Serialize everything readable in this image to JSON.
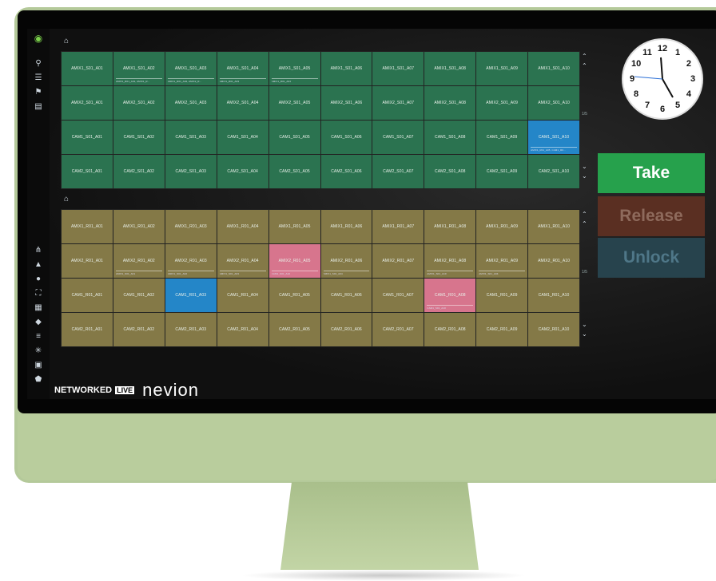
{
  "sidebar": {
    "top_icons": [
      "logo-icon",
      "routing-icon",
      "layers-icon",
      "tree-icon",
      "list-icon"
    ],
    "bottom_icons": [
      "network-icon",
      "triangle-icon",
      "eye-icon",
      "expand-icon",
      "grid-icon",
      "pin-icon",
      "list-icon",
      "snowflake-icon",
      "document-icon",
      "shield-icon"
    ]
  },
  "panels": [
    {
      "color": "#2b7350",
      "pager": "1/5",
      "rows": [
        [
          "AMIX1_S01_A01",
          "AMIX1_S01_A02",
          "AMIX1_S01_A03",
          "AMIX1_S01_A04",
          "AMIX1_S01_A05",
          "AMIX1_S01_A06",
          "AMIX1_S01_A07",
          "AMIX1_S01_A08",
          "AMIX1_S01_A09",
          "AMIX1_S01_A10"
        ],
        [
          "AMIX2_S01_A01",
          "AMIX2_S01_A02",
          "AMIX2_S01_A03",
          "AMIX2_S01_A04",
          "AMIX2_S01_A05",
          "AMIX2_S01_A06",
          "AMIX2_S01_A07",
          "AMIX2_S01_A08",
          "AMIX2_S01_A09",
          "AMIX2_S01_A10"
        ],
        [
          "CAM1_S01_A01",
          "CAM1_S01_A02",
          "CAM1_S01_A03",
          "CAM1_S01_A04",
          "CAM1_S01_A05",
          "CAM1_S01_A06",
          "CAM1_S01_A07",
          "CAM1_S01_A08",
          "CAM1_S01_A09",
          "CAM1_S01_A10"
        ],
        [
          "CAM2_S01_A01",
          "CAM2_S01_A02",
          "CAM2_S01_A03",
          "CAM2_S01_A04",
          "CAM2_S01_A05",
          "CAM2_S01_A06",
          "CAM2_S01_A07",
          "CAM2_S01_A08",
          "CAM2_S01_A09",
          "CAM2_S01_A10"
        ]
      ],
      "highlights": [
        {
          "row": 2,
          "col": 9,
          "kind": "blue"
        }
      ],
      "subs": [
        {
          "row": 0,
          "col": 1,
          "text": "AMIX1_R01_A01, AMIX1_R..."
        },
        {
          "row": 0,
          "col": 2,
          "text": "AMIX1_R01_A02, AMIX2_R..."
        },
        {
          "row": 0,
          "col": 3,
          "text": "AMIX1_R01_A03"
        },
        {
          "row": 0,
          "col": 4,
          "text": "AMIX1_R01_A04"
        },
        {
          "row": 2,
          "col": 9,
          "text": "AMIX1_R01_A05, CAM1_R0..."
        }
      ]
    },
    {
      "color": "#847947",
      "pager": "1/5",
      "rows": [
        [
          "AMIX1_R01_A01",
          "AMIX1_R01_A02",
          "AMIX1_R01_A03",
          "AMIX1_R01_A04",
          "AMIX1_R01_A05",
          "AMIX1_R01_A06",
          "AMIX1_R01_A07",
          "AMIX1_R01_A08",
          "AMIX1_R01_A09",
          "AMIX1_R01_A10"
        ],
        [
          "AMIX2_R01_A01",
          "AMIX2_R01_A02",
          "AMIX2_R01_A03",
          "AMIX2_R01_A04",
          "AMIX2_R01_A05",
          "AMIX2_R01_A06",
          "AMIX2_R01_A07",
          "AMIX2_R01_A08",
          "AMIX2_R01_A09",
          "AMIX2_R01_A10"
        ],
        [
          "CAM1_R01_A01",
          "CAM1_R01_A02",
          "CAM1_R01_A03",
          "CAM1_R01_A04",
          "CAM1_R01_A05",
          "CAM1_R01_A06",
          "CAM1_R01_A07",
          "CAM1_R01_A08",
          "CAM1_R01_A09",
          "CAM1_R01_A10"
        ],
        [
          "CAM2_R01_A01",
          "CAM2_R01_A02",
          "CAM2_R01_A03",
          "CAM2_R01_A04",
          "CAM2_R01_A05",
          "CAM2_R01_A06",
          "CAM2_R01_A07",
          "CAM2_R01_A08",
          "CAM2_R01_A09",
          "CAM2_R01_A10"
        ]
      ],
      "highlights": [
        {
          "row": 1,
          "col": 4,
          "kind": "pink"
        },
        {
          "row": 2,
          "col": 2,
          "kind": "blue"
        },
        {
          "row": 2,
          "col": 7,
          "kind": "pink"
        }
      ],
      "subs": [
        {
          "row": 1,
          "col": 1,
          "text": "AMIX1_S01_A01"
        },
        {
          "row": 1,
          "col": 2,
          "text": "AMIX1_S01_A02"
        },
        {
          "row": 1,
          "col": 3,
          "text": "AMIX1_S01_A03"
        },
        {
          "row": 1,
          "col": 4,
          "text": "CAM1_S01_A10"
        },
        {
          "row": 1,
          "col": 5,
          "text": "AMIX1_S01_A04"
        },
        {
          "row": 1,
          "col": 7,
          "text": "AMIX1_S01_A10"
        },
        {
          "row": 1,
          "col": 8,
          "text": "AMIX1_S01_A04"
        },
        {
          "row": 2,
          "col": 7,
          "text": "CAM1_S01_A10"
        }
      ]
    }
  ],
  "clock": {
    "numbers": [
      "12",
      "1",
      "2",
      "3",
      "4",
      "5",
      "6",
      "7",
      "8",
      "9",
      "10",
      "11"
    ]
  },
  "actions": {
    "take": "Take",
    "release": "Release",
    "unlock": "Unlock"
  },
  "brand": {
    "networked": "NETWORKED",
    "live": "LIVE",
    "company": "nevion"
  }
}
